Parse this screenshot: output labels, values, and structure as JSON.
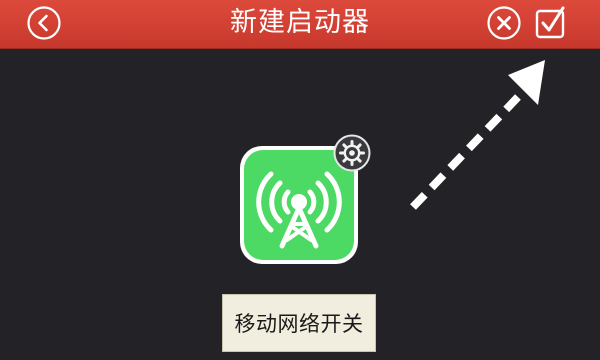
{
  "header": {
    "title": "新建启动器",
    "accent_color": "#d33f31"
  },
  "toolbar": {
    "back_icon": "chevron-left-icon",
    "cancel_icon": "close-circle-icon",
    "confirm_icon": "checkbox-check-icon"
  },
  "launcher": {
    "icon": "cell-tower-icon",
    "icon_color": "#4cd964",
    "settings_icon": "gear-icon",
    "label": "移动网络开关"
  },
  "hint": {
    "icon": "dashed-arrow-icon"
  }
}
